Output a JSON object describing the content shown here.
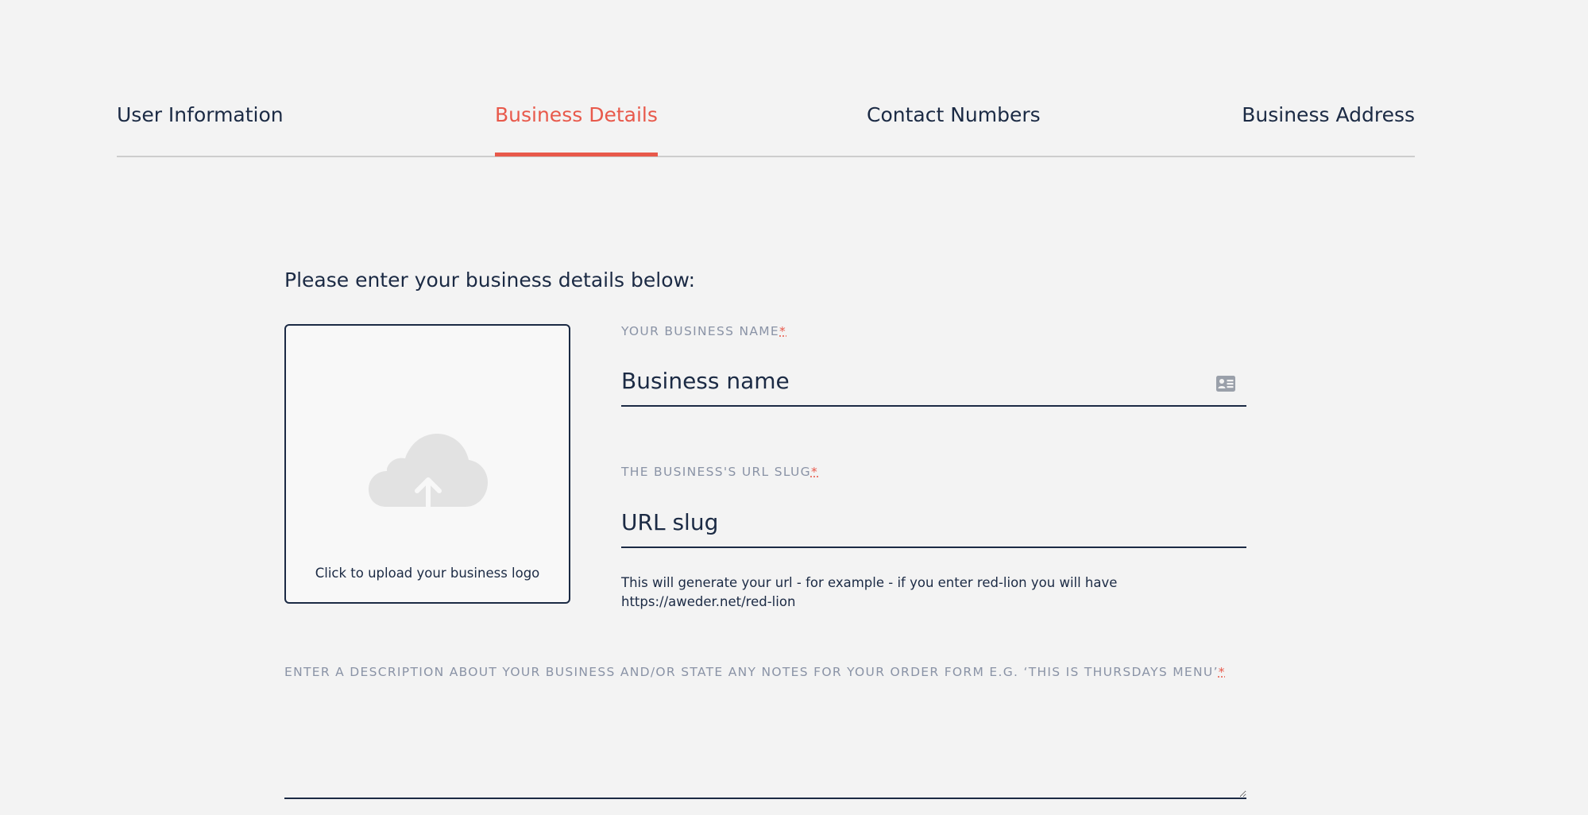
{
  "tabs": [
    {
      "label": "User Information",
      "active": false
    },
    {
      "label": "Business Details",
      "active": true
    },
    {
      "label": "Contact Numbers",
      "active": false
    },
    {
      "label": "Business Address",
      "active": false
    }
  ],
  "form": {
    "intro": "Please enter your business details below:",
    "upload": {
      "label": "Click to upload your business logo",
      "icon": "cloud-upload-icon"
    },
    "business_name": {
      "label": "YOUR BUSINESS NAME",
      "required_mark": "*",
      "placeholder": "Business name",
      "value": "",
      "icon": "id-card-icon"
    },
    "url_slug": {
      "label": "THE BUSINESS'S URL SLUG",
      "required_mark": "*",
      "placeholder": "URL slug",
      "value": "",
      "hint": "This will generate your url - for example - if you enter red-lion you will have https://aweder.net/red-lion"
    },
    "description": {
      "label": "ENTER A DESCRIPTION ABOUT YOUR BUSINESS AND/OR STATE ANY NOTES FOR YOUR ORDER FORM E.G. ‘THIS IS THURSDAYS MENU’",
      "required_mark": "*",
      "value": ""
    }
  },
  "colors": {
    "accent": "#e8594b",
    "text": "#1b2a44",
    "label": "#8a93a6",
    "background": "#f3f3f3"
  }
}
